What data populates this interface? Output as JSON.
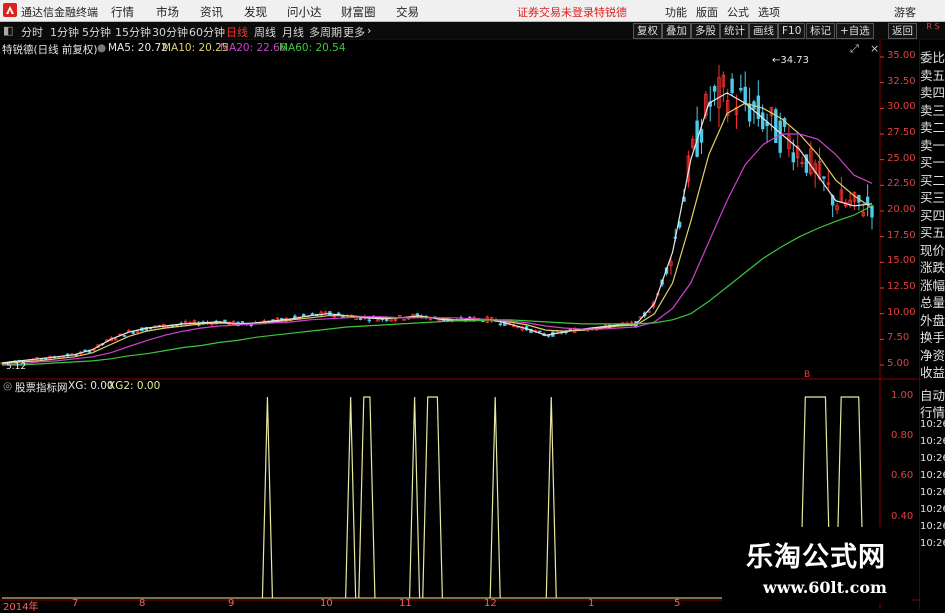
{
  "titlebar": {
    "app_title": "通达信金融终端",
    "menu": [
      "行情",
      "市场",
      "资讯",
      "发现",
      "问小达",
      "财富圈",
      "交易"
    ],
    "status": "证券交易未登录",
    "stock": "特锐德",
    "right_menu": [
      "功能",
      "版面",
      "公式",
      "选项"
    ],
    "guest": "游客"
  },
  "periodbar": {
    "items": [
      "分时",
      "1分钟",
      "5分钟",
      "15分钟",
      "30分钟",
      "60分钟",
      "日线",
      "周线",
      "月线",
      "多周期",
      "更多"
    ],
    "active": "日线",
    "right_buttons": [
      "复权",
      "叠加",
      "多股",
      "统计",
      "画线",
      "F10",
      "标记",
      "+自选",
      "返回"
    ]
  },
  "main_info": {
    "title": "特锐德(日线 前复权)",
    "ma5": "MA5: 20.72",
    "ma10": "MA10: 20.25",
    "ma20": "MA20: 22.66",
    "ma60": "MA60: 20.54"
  },
  "colors": {
    "up": "#ff3030",
    "down": "#4fc9e8",
    "ma5": "#e8e8e8",
    "ma10": "#e0d068",
    "ma20": "#d040d0",
    "ma60": "#3cc63c",
    "indicator": "#e8e8a0",
    "scale": "#e04040"
  },
  "sub_info": {
    "title": "股票指标网",
    "xg": "XG: 0.00",
    "xg2": "XG2: 0.00"
  },
  "chart_data": [
    {
      "type": "candlestick",
      "title": "特锐德(日线 前复权)",
      "y_ticks": [
        "35.00",
        "32.50",
        "30.00",
        "27.50",
        "25.00",
        "22.50",
        "20.00",
        "17.50",
        "15.00",
        "12.50",
        "10.00",
        "7.50",
        "5.00"
      ],
      "ylim": [
        5.0,
        35.0
      ],
      "annotations": {
        "high": "34.73",
        "low": "5.12"
      },
      "series": [
        {
          "name": "MA5",
          "values": [
            5.2,
            5.4,
            5.6,
            5.8,
            6.0,
            6.5,
            7.5,
            8.2,
            8.6,
            8.8,
            9.0,
            9.1,
            9.2,
            9.0,
            9.1,
            9.3,
            9.5,
            9.8,
            10.0,
            9.8,
            9.6,
            9.5,
            9.6,
            9.8,
            9.5,
            9.3,
            9.5,
            9.4,
            9.0,
            8.5,
            7.9,
            8.2,
            8.5,
            8.7,
            8.9,
            9.0,
            11.0,
            16.0,
            25.0,
            30.5,
            31.5,
            30.5,
            29.0,
            27.5,
            26.0,
            23.5,
            21.0,
            20.5,
            20.7
          ]
        },
        {
          "name": "MA10",
          "values": [
            5.1,
            5.3,
            5.4,
            5.6,
            5.8,
            6.2,
            7.0,
            7.8,
            8.3,
            8.6,
            8.8,
            9.0,
            9.1,
            9.0,
            9.0,
            9.2,
            9.4,
            9.6,
            9.8,
            9.8,
            9.7,
            9.6,
            9.6,
            9.7,
            9.6,
            9.4,
            9.4,
            9.4,
            9.2,
            8.9,
            8.4,
            8.3,
            8.4,
            8.6,
            8.8,
            8.9,
            10.0,
            13.0,
            19.0,
            25.5,
            29.5,
            30.5,
            30.0,
            29.0,
            27.5,
            25.5,
            23.0,
            21.5,
            20.3
          ]
        },
        {
          "name": "MA20",
          "values": [
            5.0,
            5.1,
            5.3,
            5.4,
            5.6,
            5.8,
            6.2,
            6.8,
            7.4,
            7.9,
            8.3,
            8.6,
            8.8,
            8.9,
            9.0,
            9.1,
            9.2,
            9.4,
            9.5,
            9.6,
            9.7,
            9.7,
            9.6,
            9.6,
            9.6,
            9.6,
            9.5,
            9.4,
            9.3,
            9.1,
            8.8,
            8.6,
            8.5,
            8.5,
            8.6,
            8.7,
            9.2,
            10.5,
            13.0,
            17.0,
            21.0,
            24.5,
            26.5,
            27.5,
            27.5,
            27.0,
            25.5,
            23.5,
            22.7
          ]
        },
        {
          "name": "MA60",
          "values": [
            5.0,
            5.0,
            5.1,
            5.2,
            5.3,
            5.4,
            5.6,
            5.9,
            6.1,
            6.4,
            6.7,
            6.9,
            7.2,
            7.4,
            7.7,
            7.9,
            8.1,
            8.3,
            8.5,
            8.7,
            8.8,
            8.9,
            9.0,
            9.1,
            9.2,
            9.3,
            9.3,
            9.4,
            9.4,
            9.3,
            9.2,
            9.1,
            9.0,
            9.0,
            9.0,
            9.0,
            9.1,
            9.4,
            10.0,
            11.2,
            12.6,
            14.0,
            15.4,
            16.5,
            17.5,
            18.3,
            19.0,
            19.6,
            20.5
          ]
        }
      ]
    },
    {
      "type": "line",
      "title": "股票指标网",
      "y_ticks": [
        "1.00",
        "0.80",
        "0.60",
        "0.40"
      ],
      "ylim": [
        0,
        1
      ],
      "series": [
        {
          "name": "XG",
          "values": [
            0,
            0,
            0,
            0,
            0,
            0,
            0,
            0,
            0,
            0,
            0,
            0,
            0,
            0,
            0,
            0,
            0,
            0,
            0,
            0,
            0,
            0,
            0,
            0,
            0,
            0,
            0,
            0,
            0,
            0,
            0,
            0,
            0,
            0,
            0,
            0,
            0,
            0,
            0,
            0,
            0,
            0,
            0,
            0,
            0,
            0,
            0,
            0,
            0
          ]
        },
        {
          "name": "XG2",
          "values": [
            0,
            0,
            0,
            0,
            0,
            0,
            0,
            0,
            0,
            0,
            0,
            0,
            0,
            0,
            0,
            0,
            0,
            0,
            0,
            0,
            0,
            0,
            0,
            0,
            0,
            0,
            0,
            0,
            0,
            0,
            0,
            0,
            0,
            0,
            0,
            0,
            0,
            0,
            0,
            0,
            0,
            0,
            0,
            0,
            0,
            0,
            0,
            0,
            0
          ]
        }
      ],
      "signals": [
        {
          "start": 0.303,
          "end": 0.303
        },
        {
          "start": 0.398,
          "end": 0.398
        },
        {
          "start": 0.413,
          "end": 0.42
        },
        {
          "start": 0.471,
          "end": 0.471
        },
        {
          "start": 0.486,
          "end": 0.497
        },
        {
          "start": 0.563,
          "end": 0.563
        },
        {
          "start": 0.627,
          "end": 0.627
        },
        {
          "start": 0.917,
          "end": 0.94
        },
        {
          "start": 0.958,
          "end": 0.978
        }
      ],
      "x_ticks": [
        "2014年",
        "7",
        "8",
        "9",
        "10",
        "11",
        "12",
        "1",
        "5"
      ]
    }
  ],
  "side_labels_top": [
    "委比",
    "卖五",
    "卖四",
    "卖三",
    "卖二",
    "卖一",
    "买一",
    "买二",
    "买三",
    "买四",
    "买五",
    "现价",
    "涨跌",
    "涨幅",
    "总量",
    "外盘",
    "换手",
    "净资",
    "收益"
  ],
  "side_labels_bottom": [
    "自动",
    "行情",
    "10:26",
    "10:26",
    "10:26",
    "10:26",
    "10:26",
    "10:26",
    "10:26",
    "10:26"
  ],
  "side_top_small": [
    "R",
    "S"
  ],
  "candle_marker": "B",
  "watermark": {
    "line1": "乐淘公式网",
    "line2": "www.60lt.com"
  }
}
